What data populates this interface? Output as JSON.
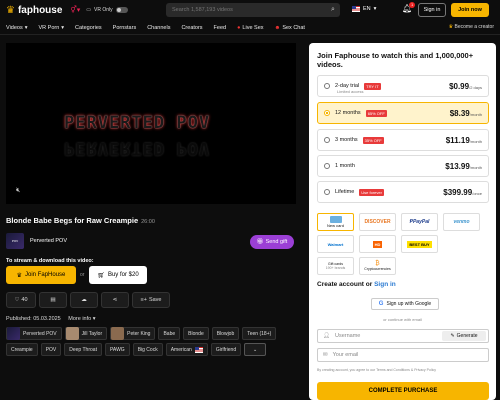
{
  "header": {
    "logo": "faphouse",
    "vr_only_label": "VR Only",
    "search_placeholder": "Search 1,587,193 videos",
    "language": "EN",
    "notification_count": "1",
    "signin_label": "Sign in",
    "joinnow_label": "Join now"
  },
  "nav": {
    "items": [
      "Videos",
      "VR Porn",
      "Categories",
      "Pornstars",
      "Channels",
      "Creators",
      "Feed",
      "Live Sex",
      "Sex Chat"
    ],
    "become_creator": "Become a creator"
  },
  "video": {
    "overlay_text": "PERVERTED POV",
    "title": "Blonde Babe Begs for Raw Creampie",
    "duration": "26:00",
    "channel_name": "Perverted POV",
    "send_gift_label": "Send gift",
    "stream_download_label": "To stream & download this video:",
    "join_label": "Join FapHouse",
    "or_label": "or",
    "buy_label": "Buy for $20",
    "like_count": "40",
    "save_label": "Save",
    "published": "Published: 05.03.2025",
    "more_info": "More info"
  },
  "tags": [
    {
      "label": "Perverted POV",
      "thumb": true
    },
    {
      "label": "Jill Taylor",
      "thumb": true
    },
    {
      "label": "Peter King",
      "thumb": true
    },
    {
      "label": "Babe",
      "thumb": false
    },
    {
      "label": "Blonde",
      "thumb": false
    },
    {
      "label": "Blowjob",
      "thumb": false
    },
    {
      "label": "Teen (18+)",
      "thumb": false
    },
    {
      "label": "Creampie",
      "thumb": false
    },
    {
      "label": "POV",
      "thumb": false
    },
    {
      "label": "Deep Throat",
      "thumb": false
    },
    {
      "label": "PAWG",
      "thumb": false
    },
    {
      "label": "Big Cock",
      "thumb": false
    },
    {
      "label": "American",
      "thumb": false
    },
    {
      "label": "Girlfriend",
      "thumb": false
    }
  ],
  "panel": {
    "heading": "Join Faphouse to watch this and 1,000,000+ videos.",
    "plans": [
      {
        "label": "2-day trial",
        "badge": "TRY IT",
        "sub": "Limited access",
        "price": "$0.99",
        "per": "/2 days",
        "selected": false
      },
      {
        "label": "12 months",
        "badge": "65% OFF",
        "sub": "",
        "price": "$8.39",
        "per": "/month",
        "selected": true
      },
      {
        "label": "3 months",
        "badge": "35% OFF",
        "sub": "",
        "price": "$11.19",
        "per": "/month",
        "selected": false
      },
      {
        "label": "1 month",
        "badge": "",
        "sub": "",
        "price": "$13.99",
        "per": "/month",
        "selected": false
      },
      {
        "label": "Lifetime",
        "badge": "Use forever",
        "sub": "",
        "price": "$399.99",
        "per": "/once",
        "selected": false
      }
    ],
    "payments": {
      "new_card": "New card",
      "discover": "DISCOVER",
      "paypal": "PayPal",
      "venmo": "venmo",
      "walmart": "Walmart",
      "homedepot": "HD",
      "bestbuy": "BEST BUY",
      "giftcards": "Gift cards",
      "giftcards_sub": "190+ brands",
      "crypto": "Cryptocurrencies"
    },
    "create_account": "Create account",
    "or_word": "or",
    "sign_in": "Sign in",
    "google_label": "Sign up with Google",
    "continue_email": "or continue with email",
    "username_placeholder": "Username",
    "generate_label": "Generate",
    "email_placeholder": "Your email",
    "terms": "By creating account, you agree to our Terms and Conditions & Privacy Policy",
    "complete_label": "COMPLETE PURCHASE"
  },
  "colors": {
    "accent": "#f7b500",
    "gift": "#9b3fd6",
    "sale_badge": "#e83a3a"
  }
}
